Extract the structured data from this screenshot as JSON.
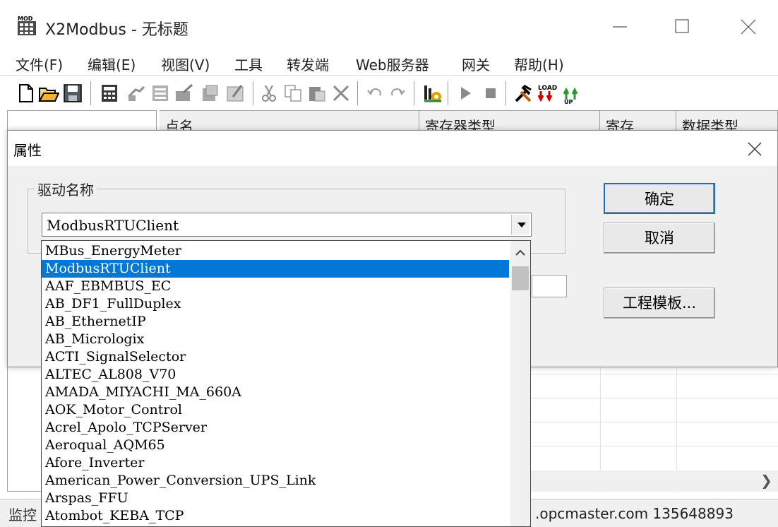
{
  "window": {
    "title": "X2Modbus - 无标题"
  },
  "menubar": {
    "items": [
      "文件(F)",
      "编辑(E)",
      "视图(V)",
      "工具",
      "转发端",
      "Web服务器",
      "网关",
      "帮助(H)"
    ]
  },
  "toolbar": {
    "buttons": [
      "new-icon",
      "open-icon",
      "save-icon",
      "calculator-icon",
      "add-device-icon",
      "add-group-icon",
      "add-tag-icon",
      "import-icon",
      "properties-icon",
      "cut-icon",
      "copy-icon",
      "paste-icon",
      "delete-icon",
      "undo-icon",
      "redo-icon",
      "run-config-icon",
      "start-icon",
      "stop-icon",
      "tools-icon",
      "load-icon",
      "upload-icon"
    ]
  },
  "grid": {
    "columns": [
      "点名",
      "寄存器类型",
      "寄存",
      "数据类型"
    ]
  },
  "status": {
    "left": "监控",
    "right": ".opcmaster.com 135648893"
  },
  "dialog": {
    "title": "属性",
    "group_label": "驱动名称",
    "selected_driver": "ModbusRTUClient",
    "ok_label": "确定",
    "cancel_label": "取消",
    "template_label": "工程模板..."
  },
  "dropdown": {
    "items": [
      "MBus_EnergyMeter",
      "ModbusRTUClient",
      "AAF_EBMBUS_EC",
      "AB_DF1_FullDuplex",
      "AB_EthernetIP",
      "AB_Micrologix",
      "ACTI_SignalSelector",
      "ALTEC_AL808_V70",
      "AMADA_MIYACHI_MA_660A",
      "AOK_Motor_Control",
      "Acrel_Apolo_TCPServer",
      "Aeroqual_AQM65",
      "Afore_Inverter",
      "American_Power_Conversion_UPS_Link",
      "Arspas_FFU",
      "Atombot_KEBA_TCP"
    ],
    "selected_index": 1
  },
  "colors": {
    "selection": "#0078d7",
    "dialog_bg": "#f0f0f0",
    "default_button_border": "#0e6fd0"
  }
}
